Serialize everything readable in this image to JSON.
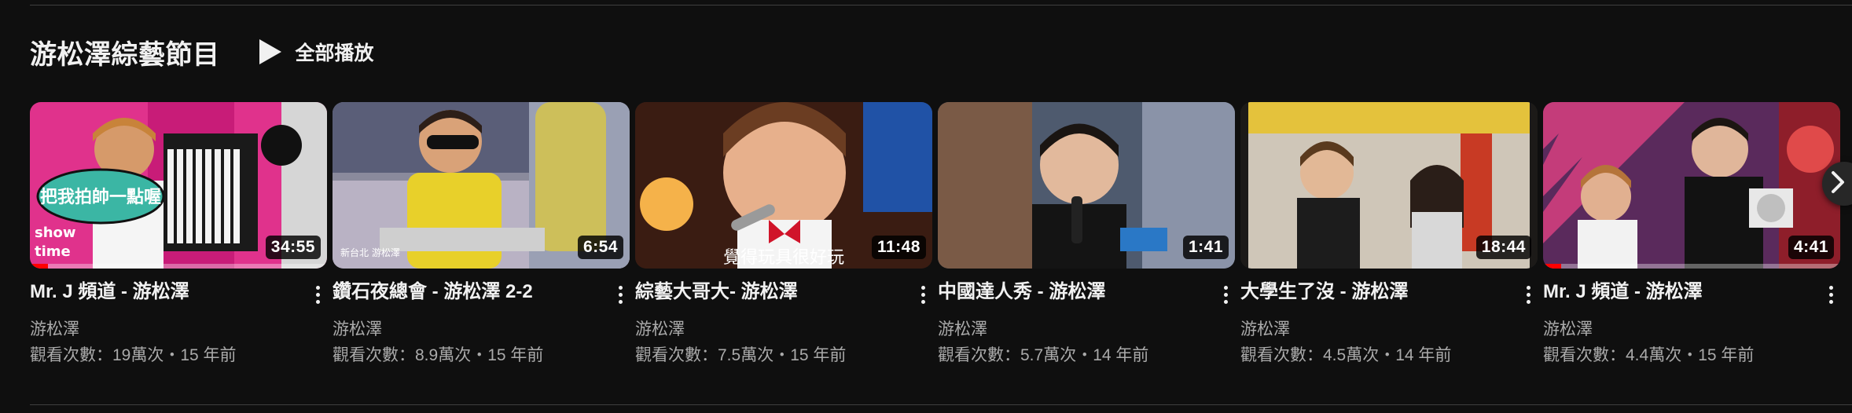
{
  "shelf": {
    "title": "游松澤綜藝節目",
    "play_all_label": "全部播放",
    "play_icon": "play-icon",
    "next_icon": "chevron-right-icon"
  },
  "colors": {
    "background": "#0f0f0f",
    "progress": "#ff0000",
    "secondary_text": "#aaaaaa"
  },
  "videos": [
    {
      "title": "Mr. J 頻道 - 游松澤",
      "channel": "游松澤",
      "stats": "觀看次數：19萬次・15 年前",
      "duration": "34:55",
      "watched_fraction": 0.06,
      "thumbnail_text": "把我拍帥一點喔"
    },
    {
      "title": "鑽石夜總會 - 游松澤 2-2",
      "channel": "游松澤",
      "stats": "觀看次數：8.9萬次・15 年前",
      "duration": "6:54",
      "watched_fraction": 0,
      "thumbnail_text": ""
    },
    {
      "title": "綜藝大哥大- 游松澤",
      "channel": "游松澤",
      "stats": "觀看次數：7.5萬次・15 年前",
      "duration": "11:48",
      "watched_fraction": 0,
      "thumbnail_text": "覺得玩具很好玩"
    },
    {
      "title": "中國達人秀 - 游松澤",
      "channel": "游松澤",
      "stats": "觀看次數：5.7萬次・14 年前",
      "duration": "1:41",
      "watched_fraction": 0,
      "thumbnail_text": ""
    },
    {
      "title": "大學生了沒 - 游松澤",
      "channel": "游松澤",
      "stats": "觀看次數：4.5萬次・14 年前",
      "duration": "18:44",
      "watched_fraction": 0,
      "thumbnail_text": ""
    },
    {
      "title": "Mr. J 頻道 - 游松澤",
      "channel": "游松澤",
      "stats": "觀看次數：4.4萬次・15 年前",
      "duration": "4:41",
      "watched_fraction": 0.06,
      "thumbnail_text": ""
    }
  ]
}
